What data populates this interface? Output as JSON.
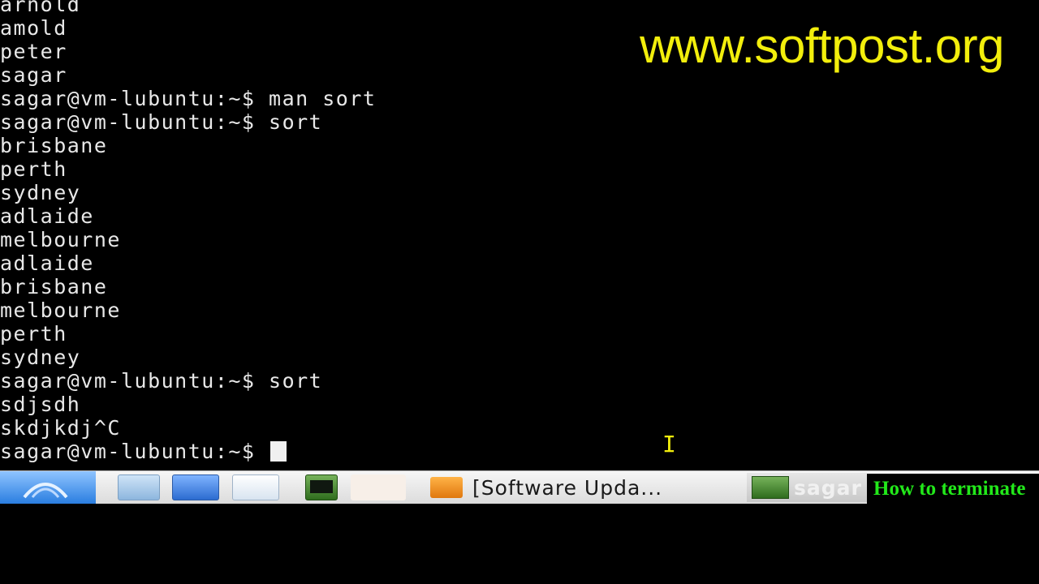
{
  "terminal": {
    "lines": [
      "arnold",
      "amold",
      "peter",
      "sagar",
      "sagar@vm-lubuntu:~$ man sort",
      "sagar@vm-lubuntu:~$ sort",
      "brisbane",
      "perth",
      "sydney",
      "adlaide",
      "melbourne",
      "adlaide",
      "brisbane",
      "melbourne",
      "perth",
      "sydney",
      "sagar@vm-lubuntu:~$ sort",
      "sdjsdh",
      "skdjkdj^C"
    ],
    "prompt": "sagar@vm-lubuntu:~$ "
  },
  "watermark": "www.softpost.org",
  "taskbar": {
    "software_update_label": "[Software Upda...",
    "terminal_task_label": "sagar"
  },
  "caption": "How to terminate",
  "colors": {
    "watermark": "#f2ee0c",
    "caption": "#22e81a",
    "terminal_bg": "#000000",
    "terminal_fg": "#e8e8e8"
  }
}
